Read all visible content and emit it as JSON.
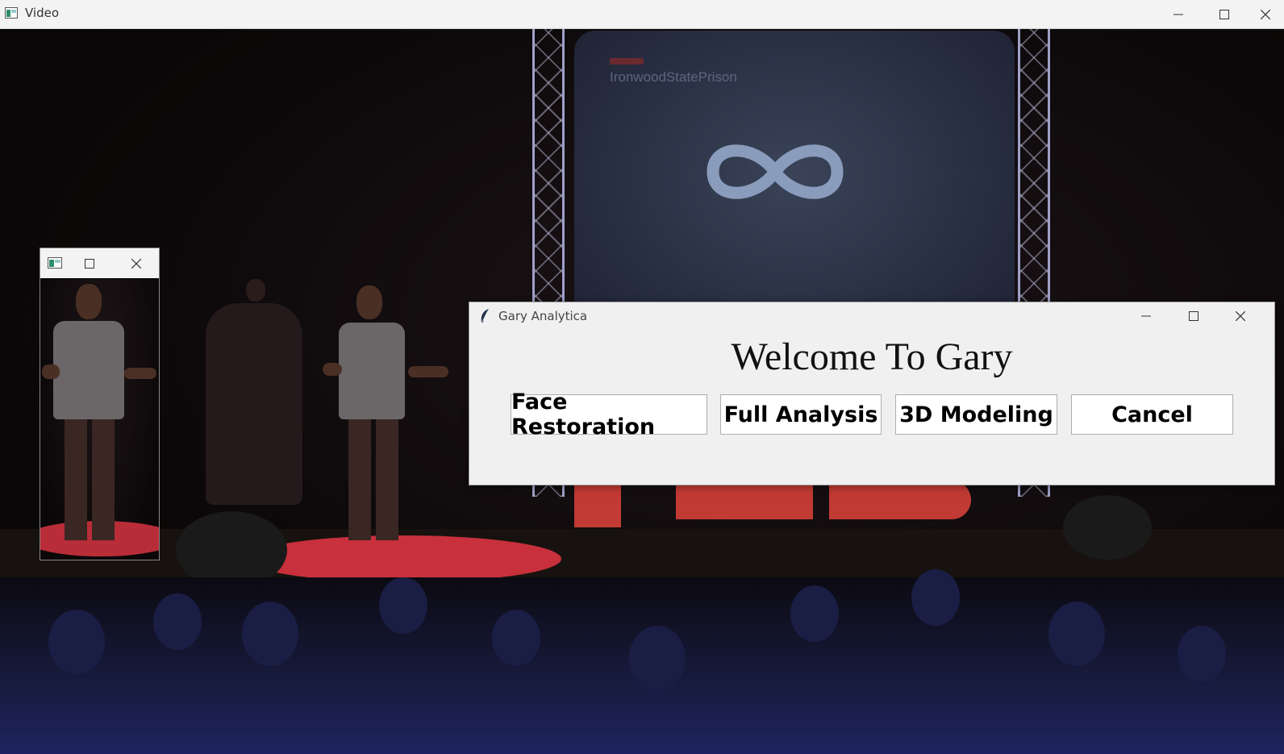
{
  "window": {
    "title": "Video",
    "icon": "app-window-icon",
    "controls": [
      "minimize-icon",
      "maximize-icon",
      "close-icon"
    ]
  },
  "video_scene": {
    "screen_text": "IronwoodStatePrison"
  },
  "preview_window": {
    "icon": "app-window-icon",
    "controls": [
      "maximize-icon",
      "close-icon"
    ]
  },
  "dialog": {
    "title": "Gary Analytica",
    "icon": "feather-icon",
    "heading": "Welcome To Gary",
    "buttons": {
      "face_restoration": "Face Restoration",
      "full_analysis": "Full Analysis",
      "modeling_3d": "3D Modeling",
      "cancel": "Cancel"
    },
    "controls": [
      "minimize-icon",
      "maximize-icon",
      "close-icon"
    ]
  }
}
